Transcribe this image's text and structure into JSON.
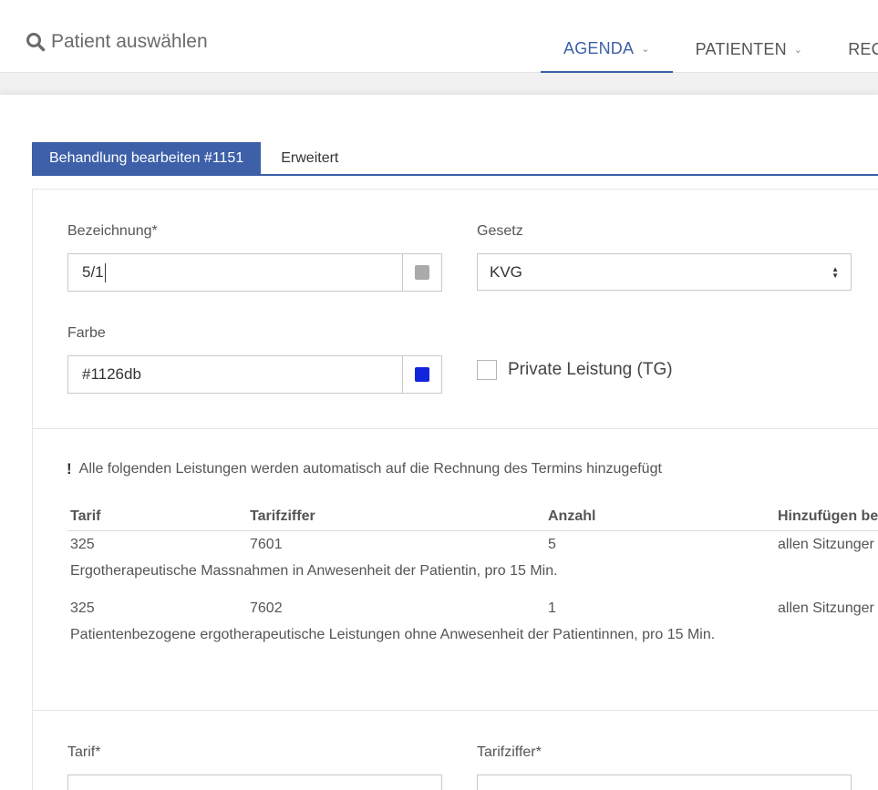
{
  "header": {
    "search_label": "Patient auswählen",
    "nav": [
      {
        "label": "AGENDA",
        "chevron": "⌄"
      },
      {
        "label": "PATIENTEN",
        "chevron": "⌄"
      },
      {
        "label": "REC"
      }
    ],
    "accent_color": "#3d60a8"
  },
  "tabs": [
    {
      "label": "Behandlung bearbeiten #1151"
    },
    {
      "label": "Erweitert"
    }
  ],
  "form": {
    "bezeichnung_label": "Bezeichnung*",
    "bezeichnung_value": "5/1",
    "bezeichnung_swatch": "#aaaaaa",
    "gesetz_label": "Gesetz",
    "gesetz_value": "KVG",
    "farbe_label": "Farbe",
    "farbe_value": "#1126db",
    "farbe_swatch": "#1126db",
    "private_label": "Private Leistung (TG)",
    "private_checked": false,
    "tarif_label": "Tarif*",
    "tarifziffer_label": "Tarifziffer*"
  },
  "notice": {
    "icon": "!",
    "text": "Alle folgenden Leistungen werden automatisch auf die Rechnung des Termins hinzugefügt"
  },
  "table": {
    "headers": [
      "Tarif",
      "Tarifziffer",
      "Anzahl",
      "Hinzufügen be"
    ],
    "rows": [
      {
        "tarif": "325",
        "tarifziffer": "7601",
        "anzahl": "5",
        "hinzufuegen": "allen Sitzunger",
        "description": "Ergotherapeutische Massnahmen in Anwesenheit der Patientin, pro 15 Min."
      },
      {
        "tarif": "325",
        "tarifziffer": "7602",
        "anzahl": "1",
        "hinzufuegen": "allen Sitzunger",
        "description": "Patientenbezogene ergotherapeutische Leistungen ohne Anwesenheit der Patientinnen, pro 15 Min."
      }
    ]
  }
}
